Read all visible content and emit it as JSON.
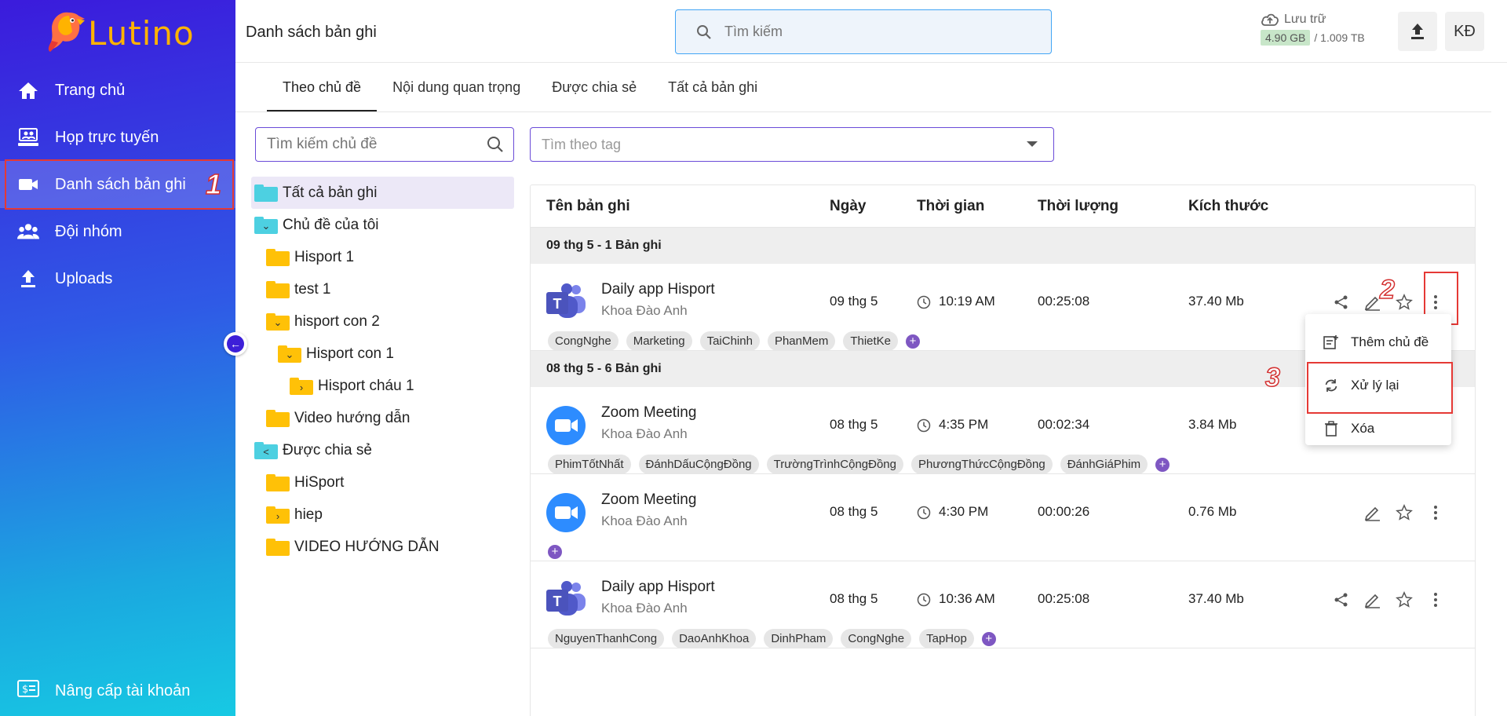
{
  "app": {
    "logo_text": "Lutino"
  },
  "sidebar": {
    "items": [
      {
        "label": "Trang chủ",
        "icon": "home-icon"
      },
      {
        "label": "Họp trực tuyến",
        "icon": "video-call-icon"
      },
      {
        "label": "Danh sách bản ghi",
        "icon": "videocam-icon",
        "active": true,
        "marker": "1"
      },
      {
        "label": "Đội nhóm",
        "icon": "group-icon"
      },
      {
        "label": "Uploads",
        "icon": "upload-icon"
      }
    ],
    "upgrade_label": "Nâng cấp tài khoản"
  },
  "header": {
    "title": "Danh sách bản ghi",
    "search_placeholder": "Tìm kiếm",
    "storage_label": "Lưu trữ",
    "storage_used": "4.90 GB",
    "storage_total": "/ 1.009 TB",
    "avatar_initials": "KĐ"
  },
  "tabs": [
    "Theo chủ đề",
    "Nội dung quan trọng",
    "Được chia sẻ",
    "Tất cả bản ghi"
  ],
  "topic_search_placeholder": "Tìm kiếm chủ đề",
  "tag_search_placeholder": "Tìm theo tag",
  "tree": [
    {
      "label": "Tất cả bản ghi",
      "color": "#4dd0e1",
      "selected": true,
      "glyph": ""
    },
    {
      "label": "Chủ đề của tôi",
      "color": "#4dd0e1",
      "glyph": "⌄"
    },
    {
      "label": "Hisport 1",
      "color": "#ffc107",
      "glyph": ""
    },
    {
      "label": "test 1",
      "color": "#ffc107",
      "glyph": ""
    },
    {
      "label": "hisport con 2",
      "color": "#ffc107",
      "glyph": "⌄"
    },
    {
      "label": "Hisport con 1",
      "color": "#ffc107",
      "glyph": "⌄"
    },
    {
      "label": "Hisport cháu 1",
      "color": "#ffc107",
      "glyph": "›"
    },
    {
      "label": "Video hướng dẫn",
      "color": "#ffc107",
      "glyph": ""
    },
    {
      "label": "Được chia sẻ",
      "color": "#4dd0e1",
      "glyph": "<"
    },
    {
      "label": "HiSport",
      "color": "#ffc107",
      "glyph": ""
    },
    {
      "label": "hiep",
      "color": "#ffc107",
      "glyph": "›"
    },
    {
      "label": "VIDEO HƯỚNG DẪN",
      "color": "#ffc107",
      "glyph": ""
    }
  ],
  "table": {
    "headers": [
      "Tên bản ghi",
      "Ngày",
      "Thời gian",
      "Thời lượng",
      "Kích thước"
    ],
    "groups": [
      {
        "label": "09 thg 5 - 1 Bản ghi",
        "rows": [
          {
            "app": "teams",
            "title": "Daily app Hisport",
            "owner": "Khoa Đào Anh",
            "date": "09 thg 5",
            "time": "10:19 AM",
            "duration": "00:25:08",
            "size": "37.40 Mb",
            "tags": [
              "CongNghe",
              "Marketing",
              "TaiChinh",
              "PhanMem",
              "ThietKe"
            ]
          }
        ]
      },
      {
        "label": "08 thg 5 - 6 Bản ghi",
        "rows": [
          {
            "app": "zoom",
            "title": "Zoom Meeting",
            "owner": "Khoa Đào Anh",
            "date": "08 thg 5",
            "time": "4:35 PM",
            "duration": "00:02:34",
            "size": "3.84 Mb",
            "tags": [
              "PhimTốtNhất",
              "ĐánhDấuCộngĐồng",
              "TrườngTrìnhCộngĐồng",
              "PhươngThứcCộngĐồng",
              "ĐánhGiáPhim"
            ]
          },
          {
            "app": "zoom",
            "title": "Zoom Meeting",
            "owner": "Khoa Đào Anh",
            "date": "08 thg 5",
            "time": "4:30 PM",
            "duration": "00:00:26",
            "size": "0.76 Mb",
            "tags": []
          },
          {
            "app": "teams",
            "title": "Daily app Hisport",
            "owner": "Khoa Đào Anh",
            "date": "08 thg 5",
            "time": "10:36 AM",
            "duration": "00:25:08",
            "size": "37.40 Mb",
            "tags": [
              "NguyenThanhCong",
              "DaoAnhKhoa",
              "DinhPham",
              "CongNghe",
              "TapHop"
            ]
          }
        ]
      }
    ]
  },
  "context_menu": [
    "Thêm chủ đề",
    "Xử lý lại",
    "Xóa"
  ],
  "markers": {
    "step2": "2",
    "step3": "3"
  },
  "colors": {
    "accent": "#3b1bdc",
    "highlight": "#e53935",
    "folder": "#ffc107",
    "shared": "#4dd0e1"
  }
}
